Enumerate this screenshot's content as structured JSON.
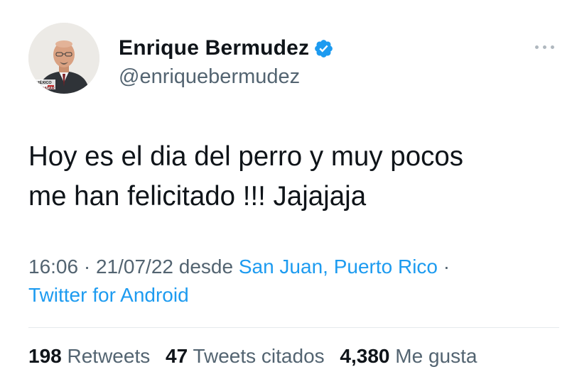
{
  "author": {
    "display_name": "Enrique Bermudez",
    "handle": "@enriquebermudez",
    "avatar_badge_lines": [
      "MÉXICO",
      "QATAR"
    ],
    "verified": true
  },
  "tweet": {
    "text": "Hoy es el dia del perro y muy pocos\nme han felicitado  !!! Jajajaja",
    "time": "16:06",
    "date": "21/07/22",
    "via_word": "desde",
    "location": "San Juan, Puerto Rico",
    "source_app": "Twitter for Android"
  },
  "stats": {
    "retweets_count": "198",
    "retweets_label": "Retweets",
    "quotes_count": "47",
    "quotes_label": "Tweets citados",
    "likes_count": "4,380",
    "likes_label": "Me gusta"
  },
  "colors": {
    "text": "#0f1419",
    "secondary": "#536471",
    "link": "#1d9bf0",
    "verified": "#1d9bf0",
    "divider": "#e6e9ec"
  },
  "icons": {
    "verified": "verified-badge-icon",
    "more": "more-options-icon"
  }
}
